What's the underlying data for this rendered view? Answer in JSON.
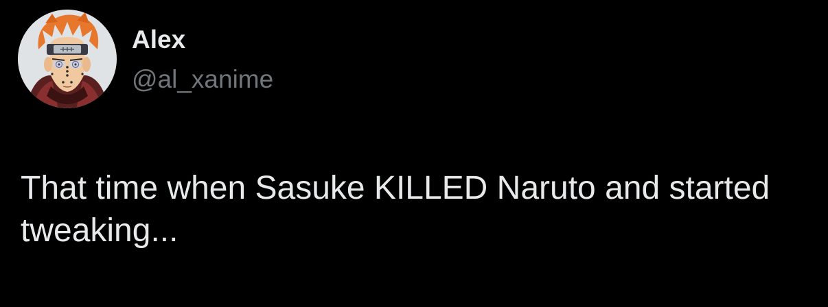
{
  "author": {
    "display_name": "Alex",
    "handle": "@al_xanime",
    "avatar_icon": "anime-character-avatar-icon"
  },
  "tweet": {
    "text": "That time when Sasuke KILLED Naruto and started tweaking..."
  },
  "colors": {
    "background": "#000000",
    "primary_text": "#e7e9ea",
    "secondary_text": "#71767b"
  }
}
